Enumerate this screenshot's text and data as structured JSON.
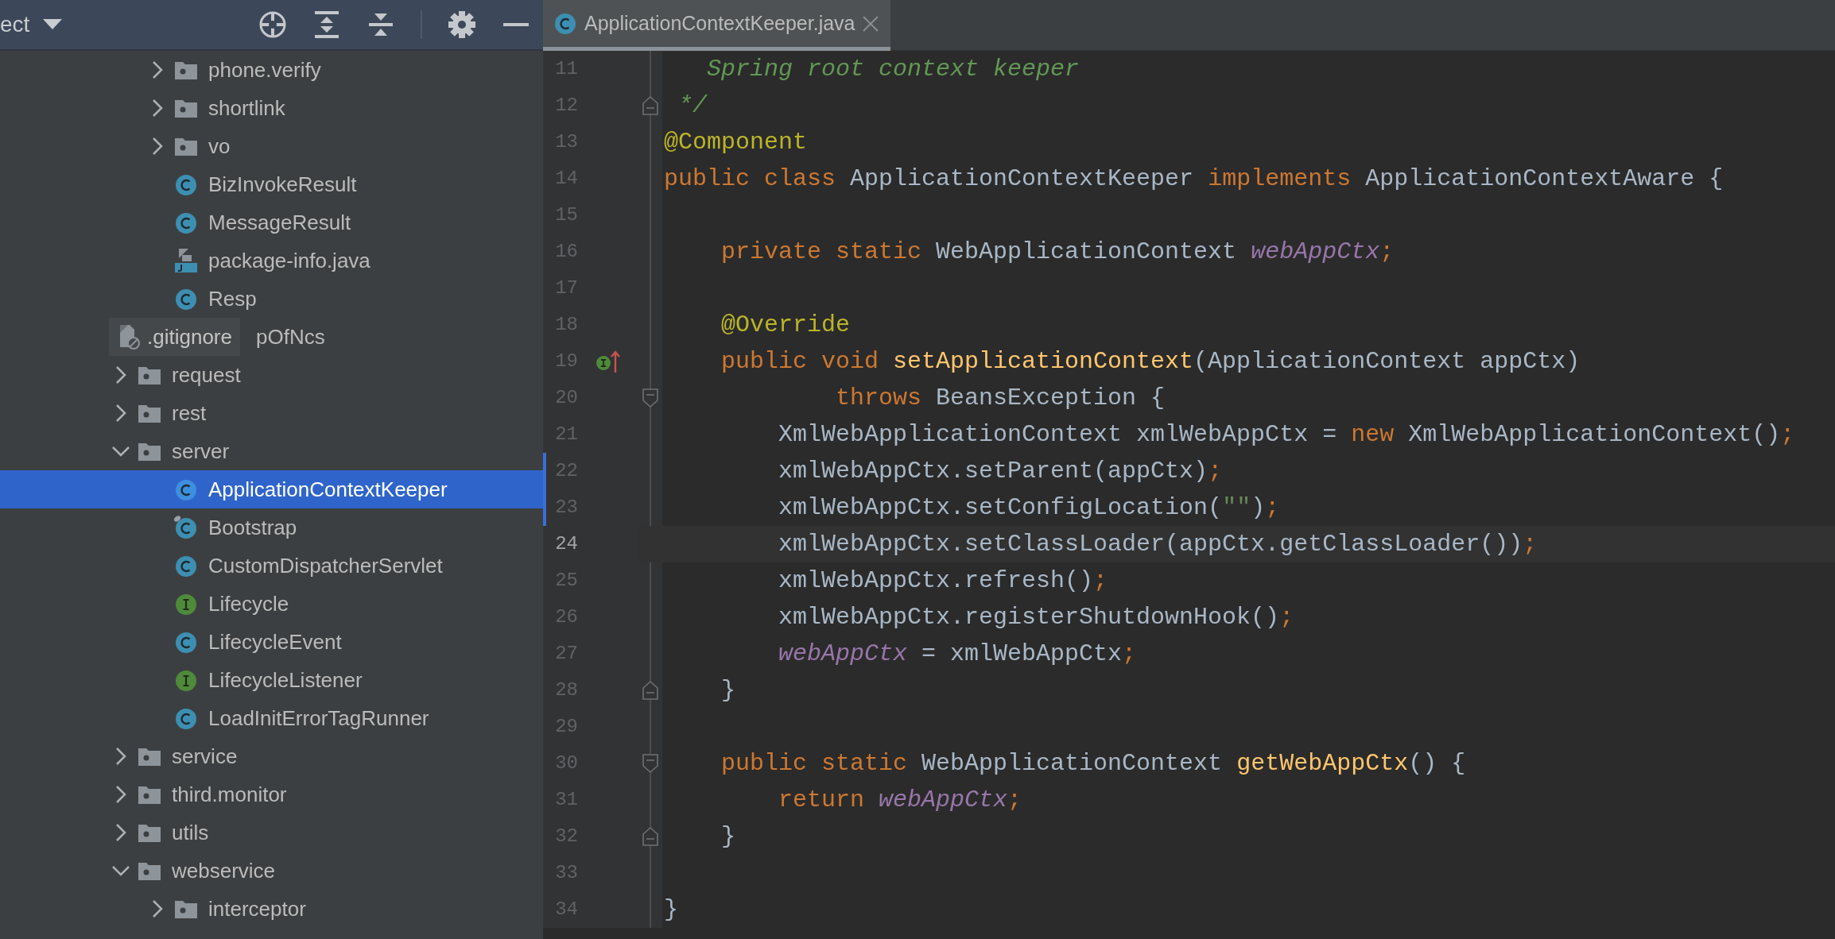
{
  "project_panel": {
    "title": "ect"
  },
  "tree": {
    "continued": [
      {
        "label": "phone.verify",
        "kind": "folder",
        "expanded": false,
        "selected": false
      },
      {
        "label": "shortlink",
        "kind": "folder",
        "expanded": false,
        "selected": false
      },
      {
        "label": "vo",
        "kind": "folder",
        "expanded": false,
        "selected": false
      },
      {
        "label": "BizInvokeResult",
        "kind": "class",
        "selected": false
      },
      {
        "label": "MessageResult",
        "kind": "class",
        "selected": false
      },
      {
        "label": "package-info.java",
        "kind": "java-file",
        "selected": false
      },
      {
        "label": "Resp",
        "kind": "class",
        "selected": false
      },
      {
        "label": "pOfNcs",
        "kind": "covered",
        "selected": false
      }
    ],
    "items": [
      {
        "label": "request",
        "kind": "folder",
        "expanded": false,
        "selected": false
      },
      {
        "label": "rest",
        "kind": "folder",
        "expanded": false,
        "selected": false
      },
      {
        "label": "server",
        "kind": "folder",
        "expanded": true,
        "selected": false,
        "children": [
          {
            "label": "ApplicationContextKeeper",
            "kind": "class",
            "selected": true
          },
          {
            "label": "Bootstrap",
            "kind": "class",
            "selected": false,
            "marked": true
          },
          {
            "label": "CustomDispatcherServlet",
            "kind": "class",
            "selected": false
          },
          {
            "label": "Lifecycle",
            "kind": "interface",
            "selected": false
          },
          {
            "label": "LifecycleEvent",
            "kind": "class",
            "selected": false
          },
          {
            "label": "LifecycleListener",
            "kind": "interface",
            "selected": false
          },
          {
            "label": "LoadInitErrorTagRunner",
            "kind": "class",
            "selected": false
          }
        ]
      },
      {
        "label": "service",
        "kind": "folder",
        "expanded": false,
        "selected": false
      },
      {
        "label": "third.monitor",
        "kind": "folder",
        "expanded": false,
        "selected": false
      },
      {
        "label": "utils",
        "kind": "folder",
        "expanded": false,
        "selected": false
      },
      {
        "label": "webservice",
        "kind": "folder",
        "expanded": true,
        "selected": false,
        "children": [
          {
            "label": "interceptor",
            "kind": "folder",
            "expanded": false,
            "selected": false
          }
        ]
      }
    ]
  },
  "tooltip": {
    "text": ".gitignore"
  },
  "tabs": [
    {
      "label": "ApplicationContextKeeper.java",
      "selected": true
    }
  ],
  "editor": {
    "lines": [
      {
        "number": "11",
        "current": false,
        "changed": false,
        "tokens": [
          {
            "kind": "comment",
            "text": "   Spring root context keeper"
          }
        ]
      },
      {
        "number": "12",
        "current": false,
        "changed": false,
        "fold_end": true,
        "tokens": [
          {
            "kind": "comment",
            "text": " */"
          }
        ]
      },
      {
        "number": "13",
        "current": false,
        "changed": false,
        "tokens": [
          {
            "kind": "annotation",
            "text": "@Component"
          }
        ]
      },
      {
        "number": "14",
        "current": false,
        "changed": false,
        "tokens": [
          {
            "kind": "keyword",
            "text": "public class "
          },
          {
            "kind": "plain",
            "text": "ApplicationContextKeeper "
          },
          {
            "kind": "keyword",
            "text": "implements "
          },
          {
            "kind": "plain",
            "text": "ApplicationContextAware {"
          }
        ]
      },
      {
        "number": "15",
        "current": false,
        "changed": false
      },
      {
        "number": "16",
        "current": false,
        "changed": false,
        "tokens": [
          {
            "kind": "keyword",
            "text": "    private static "
          },
          {
            "kind": "plain",
            "text": "WebApplicationContext "
          },
          {
            "kind": "field",
            "text": "webAppCtx"
          },
          {
            "kind": "keyword",
            "text": ";"
          }
        ]
      },
      {
        "number": "17",
        "current": false,
        "changed": false
      },
      {
        "number": "18",
        "current": false,
        "changed": false,
        "tokens": [
          {
            "kind": "annotation",
            "text": "    @Override"
          }
        ]
      },
      {
        "number": "19",
        "current": false,
        "changed": false,
        "implements_marker": true,
        "tokens": [
          {
            "kind": "keyword",
            "text": "    public void "
          },
          {
            "kind": "method",
            "text": "setApplicationContext"
          },
          {
            "kind": "plain",
            "text": "(ApplicationContext appCtx)"
          }
        ]
      },
      {
        "number": "20",
        "current": false,
        "changed": false,
        "fold_start": true,
        "tokens": [
          {
            "kind": "keyword",
            "text": "            throws "
          },
          {
            "kind": "plain",
            "text": "BeansException {"
          }
        ]
      },
      {
        "number": "21",
        "current": false,
        "changed": false,
        "tokens": [
          {
            "kind": "plain",
            "text": "        XmlWebApplicationContext xmlWebAppCtx = "
          },
          {
            "kind": "keyword",
            "text": "new "
          },
          {
            "kind": "plain",
            "text": "XmlWebApplicationContext()"
          },
          {
            "kind": "keyword",
            "text": ";"
          }
        ]
      },
      {
        "number": "22",
        "current": false,
        "changed": true,
        "tokens": [
          {
            "kind": "plain",
            "text": "        xmlWebAppCtx.setParent(appCtx)"
          },
          {
            "kind": "keyword",
            "text": ";"
          }
        ]
      },
      {
        "number": "23",
        "current": false,
        "changed": true,
        "tokens": [
          {
            "kind": "plain",
            "text": "        xmlWebAppCtx.setConfigLocation("
          },
          {
            "kind": "string",
            "text": "\"\""
          },
          {
            "kind": "plain",
            "text": ")"
          },
          {
            "kind": "keyword",
            "text": ";"
          }
        ]
      },
      {
        "number": "24",
        "current": true,
        "changed": false,
        "tokens": [
          {
            "kind": "plain",
            "text": "        xmlWebAppCtx.setClassLoader(appCtx.getClassLoader())"
          },
          {
            "kind": "keyword",
            "text": ";"
          }
        ]
      },
      {
        "number": "25",
        "current": false,
        "changed": false,
        "tokens": [
          {
            "kind": "plain",
            "text": "        xmlWebAppCtx.refresh()"
          },
          {
            "kind": "keyword",
            "text": ";"
          }
        ]
      },
      {
        "number": "26",
        "current": false,
        "changed": false,
        "tokens": [
          {
            "kind": "plain",
            "text": "        xmlWebAppCtx.registerShutdownHook()"
          },
          {
            "kind": "keyword",
            "text": ";"
          }
        ]
      },
      {
        "number": "27",
        "current": false,
        "changed": false,
        "tokens": [
          {
            "kind": "field",
            "text": "        webAppCtx"
          },
          {
            "kind": "plain",
            "text": " = xmlWebAppCtx"
          },
          {
            "kind": "keyword",
            "text": ";"
          }
        ]
      },
      {
        "number": "28",
        "current": false,
        "changed": false,
        "fold_end": true,
        "tokens": [
          {
            "kind": "plain",
            "text": "    }"
          }
        ]
      },
      {
        "number": "29",
        "current": false,
        "changed": false
      },
      {
        "number": "30",
        "current": false,
        "changed": false,
        "fold_start": true,
        "tokens": [
          {
            "kind": "keyword",
            "text": "    public static "
          },
          {
            "kind": "plain",
            "text": "WebApplicationContext "
          },
          {
            "kind": "method",
            "text": "getWebAppCtx"
          },
          {
            "kind": "plain",
            "text": "() {"
          }
        ]
      },
      {
        "number": "31",
        "current": false,
        "changed": false,
        "tokens": [
          {
            "kind": "keyword",
            "text": "        return "
          },
          {
            "kind": "field",
            "text": "webAppCtx"
          },
          {
            "kind": "keyword",
            "text": ";"
          }
        ]
      },
      {
        "number": "32",
        "current": false,
        "changed": false,
        "fold_end": true,
        "tokens": [
          {
            "kind": "plain",
            "text": "    }"
          }
        ]
      },
      {
        "number": "33",
        "current": false,
        "changed": false
      },
      {
        "number": "34",
        "current": false,
        "changed": false,
        "tokens": [
          {
            "kind": "plain",
            "text": "}"
          }
        ]
      }
    ]
  }
}
